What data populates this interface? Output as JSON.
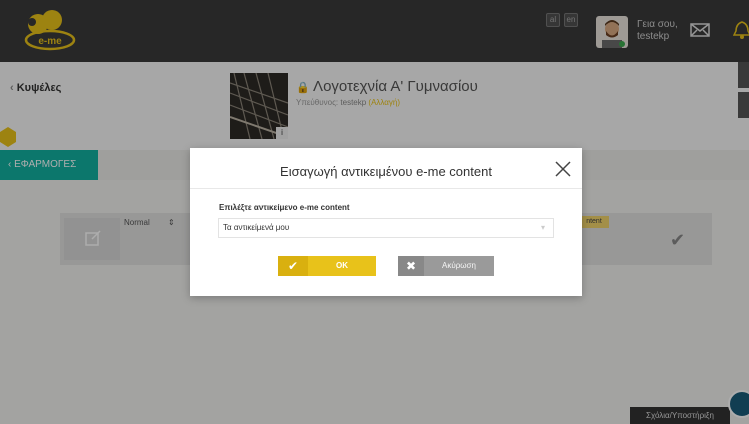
{
  "topbar": {
    "logo_text": "e-me",
    "greeting": "Γεια σου,",
    "username": "testekp",
    "mini_buttons": [
      "al",
      "en"
    ]
  },
  "header": {
    "back_label": "Κυψέλες",
    "course_title": "Λογοτεχνία Α' Γυμνασίου",
    "owner_prefix": "Υπεύθυνος:",
    "owner_name": "testekp",
    "owner_change": "(Αλλαγή)",
    "cover_info": "i",
    "apps_tab_label": "ΕΦΑΡΜΟΓΕΣ"
  },
  "background_panel": {
    "format_label": "Normal",
    "content_badge": "ntent"
  },
  "modal": {
    "title": "Εισαγωγή αντικειμένου e-me content",
    "field_label": "Επιλέξτε αντικείμενο e-me content",
    "select_value": "Τα αντικείμενά μου",
    "ok_label": "OK",
    "cancel_label": "Ακύρωση"
  },
  "footer": {
    "help_label": "Σχόλια/Υποστήριξη"
  },
  "colors": {
    "accent_yellow": "#e8c21a",
    "teal": "#12b0a0",
    "topbar_bg": "#3a3a3a"
  }
}
